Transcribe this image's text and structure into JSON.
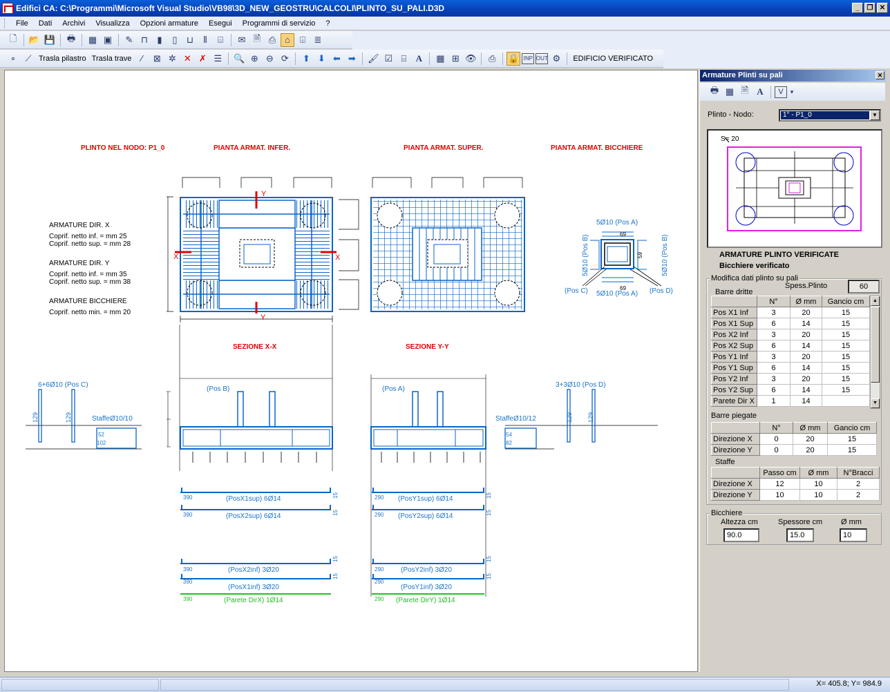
{
  "window": {
    "title": "Edifici CA:   C:\\Programmi\\Microsoft Visual Studio\\VB98\\3D_NEW_GEOSTRU\\CALCOLI\\PLINTO_SU_PALI.D3D"
  },
  "menu": [
    "File",
    "Dati",
    "Archivi",
    "Visualizza",
    "Opzioni armature",
    "Esegui",
    "Programmi di servizio",
    "?"
  ],
  "toolbar2": {
    "trasla_pilastro": "Trasla pilastro",
    "trasla_trave": "Trasla trave",
    "inp": "INP",
    "out": "OUT",
    "status": "EDIFICIO VERIFICATO"
  },
  "drawing": {
    "title_nodo": "PLINTO NEL NODO: P1_0",
    "title_infer": "PIANTA ARMAT. INFER.",
    "title_super": "PIANTA ARMAT. SUPER.",
    "title_bicchiere": "PIANTA ARMAT. BICCHIERE",
    "notes": [
      "ARMATURE DIR. X",
      "Coprif. netto inf. = mm 25",
      "Coprif. netto sup. = mm 28",
      "ARMATURE DIR. Y",
      "Coprif. netto inf. = mm 35",
      "Coprif. netto sup. = mm 38",
      "ARMATURE BICCHIERE",
      "Coprif. netto min. = mm 20"
    ],
    "axis_x": "X",
    "axis_y": "Y",
    "sezione_xx": "SEZIONE X-X",
    "sezione_yy": "SEZIONE Y-Y",
    "bic_posA": "5Ø10 (Pos A)",
    "bic_posA2": "5Ø10 (Pos A)",
    "bic_posB": "5Ø10 (Pos B)",
    "bic_posB2": "5Ø10 (Pos B)",
    "bic_posC": "(Pos C)",
    "bic_posD": "(Pos D)",
    "bic_dim": "69",
    "bic_dim2": "59",
    "posC_label": "6+6Ø10 (Pos C)",
    "posD_label": "3+3Ø10 (Pos D)",
    "staffe_x": "StaffeØ10/10",
    "staffe_y": "StaffeØ10/12",
    "posB": "(Pos B)",
    "posA": "(Pos A)",
    "dim129": "129",
    "dim52": "52",
    "dim102": "102",
    "dim54": "54",
    "dim82": "82",
    "bars_x": [
      {
        "len": "390",
        "text": "(PosX1sup) 6Ø14"
      },
      {
        "len": "390",
        "text": "(PosX2sup) 6Ø14"
      },
      {
        "len": "390",
        "text": "(PosX2inf) 3Ø20"
      },
      {
        "len": "390",
        "text": "(PosX1inf) 3Ø20"
      },
      {
        "len": "390",
        "text": "(Parete DirX) 1Ø14"
      }
    ],
    "bars_y": [
      {
        "len": "290",
        "text": "(PosY1sup) 6Ø14"
      },
      {
        "len": "290",
        "text": "(PosY2sup) 6Ø14"
      },
      {
        "len": "290",
        "text": "(PosY2inf) 3Ø20"
      },
      {
        "len": "290",
        "text": "(PosY1inf) 3Ø20"
      },
      {
        "len": "290",
        "text": "(Parete DirY) 1Ø14"
      }
    ],
    "hook": "15"
  },
  "panel": {
    "title": "Armature Plinti su pali",
    "plinto_nodo_label": "Plinto - Nodo:",
    "plinto_nodo_value": "1° -  P1_0",
    "preview_label": "S= 20",
    "verificate": "ARMATURE PLINTO VERIFICATE",
    "bicchiere_verificato": "Bicchiere verificato",
    "modifica_group": "Modifica dati plinto su pali",
    "spess_label": "Spess.Plinto",
    "spess_value": "60",
    "barre_dritte_label": "Barre dritte",
    "barre_dritte_headers": [
      "",
      "N°",
      "Ø  mm",
      "Gancio  cm"
    ],
    "barre_dritte": [
      [
        "Pos X1  Inf",
        "3",
        "20",
        "15"
      ],
      [
        "Pos X1  Sup",
        "6",
        "14",
        "15"
      ],
      [
        "Pos X2  Inf",
        "3",
        "20",
        "15"
      ],
      [
        "Pos X2  Sup",
        "6",
        "14",
        "15"
      ],
      [
        "Pos Y1  Inf",
        "3",
        "20",
        "15"
      ],
      [
        "Pos Y1  Sup",
        "6",
        "14",
        "15"
      ],
      [
        "Pos Y2  Inf",
        "3",
        "20",
        "15"
      ],
      [
        "Pos Y2  Sup",
        "6",
        "14",
        "15"
      ],
      [
        "Parete Dir X",
        "1",
        "14",
        ""
      ]
    ],
    "barre_piegate_label": "Barre piegate",
    "barre_piegate_headers": [
      "",
      "N°",
      "Ø  mm",
      "Gancio cm"
    ],
    "barre_piegate": [
      [
        "Direzione  X",
        "0",
        "20",
        "15"
      ],
      [
        "Direzione  Y",
        "0",
        "20",
        "15"
      ]
    ],
    "staffe_label": "Staffe",
    "staffe_headers": [
      "",
      "Passo  cm",
      "Ø  mm",
      "N°Bracci"
    ],
    "staffe": [
      [
        "Direzione X",
        "12",
        "10",
        "2"
      ],
      [
        "Direzione Y",
        "10",
        "10",
        "2"
      ]
    ],
    "bicchiere_group": "Bicchiere",
    "altezza_label": "Altezza cm",
    "spessore_label": "Spessore cm",
    "diam_label": "Ø  mm",
    "altezza_value": "90.0",
    "spessore_value": "15.0",
    "diam_value": "10"
  },
  "status": {
    "coords": "X=  405.8;  Y=  984.9"
  },
  "colors": {
    "rebar": "#0a64c8",
    "label_red": "#e00000",
    "label_blue": "#1a73c9",
    "green": "#22c022",
    "magenta": "#e020e0"
  }
}
